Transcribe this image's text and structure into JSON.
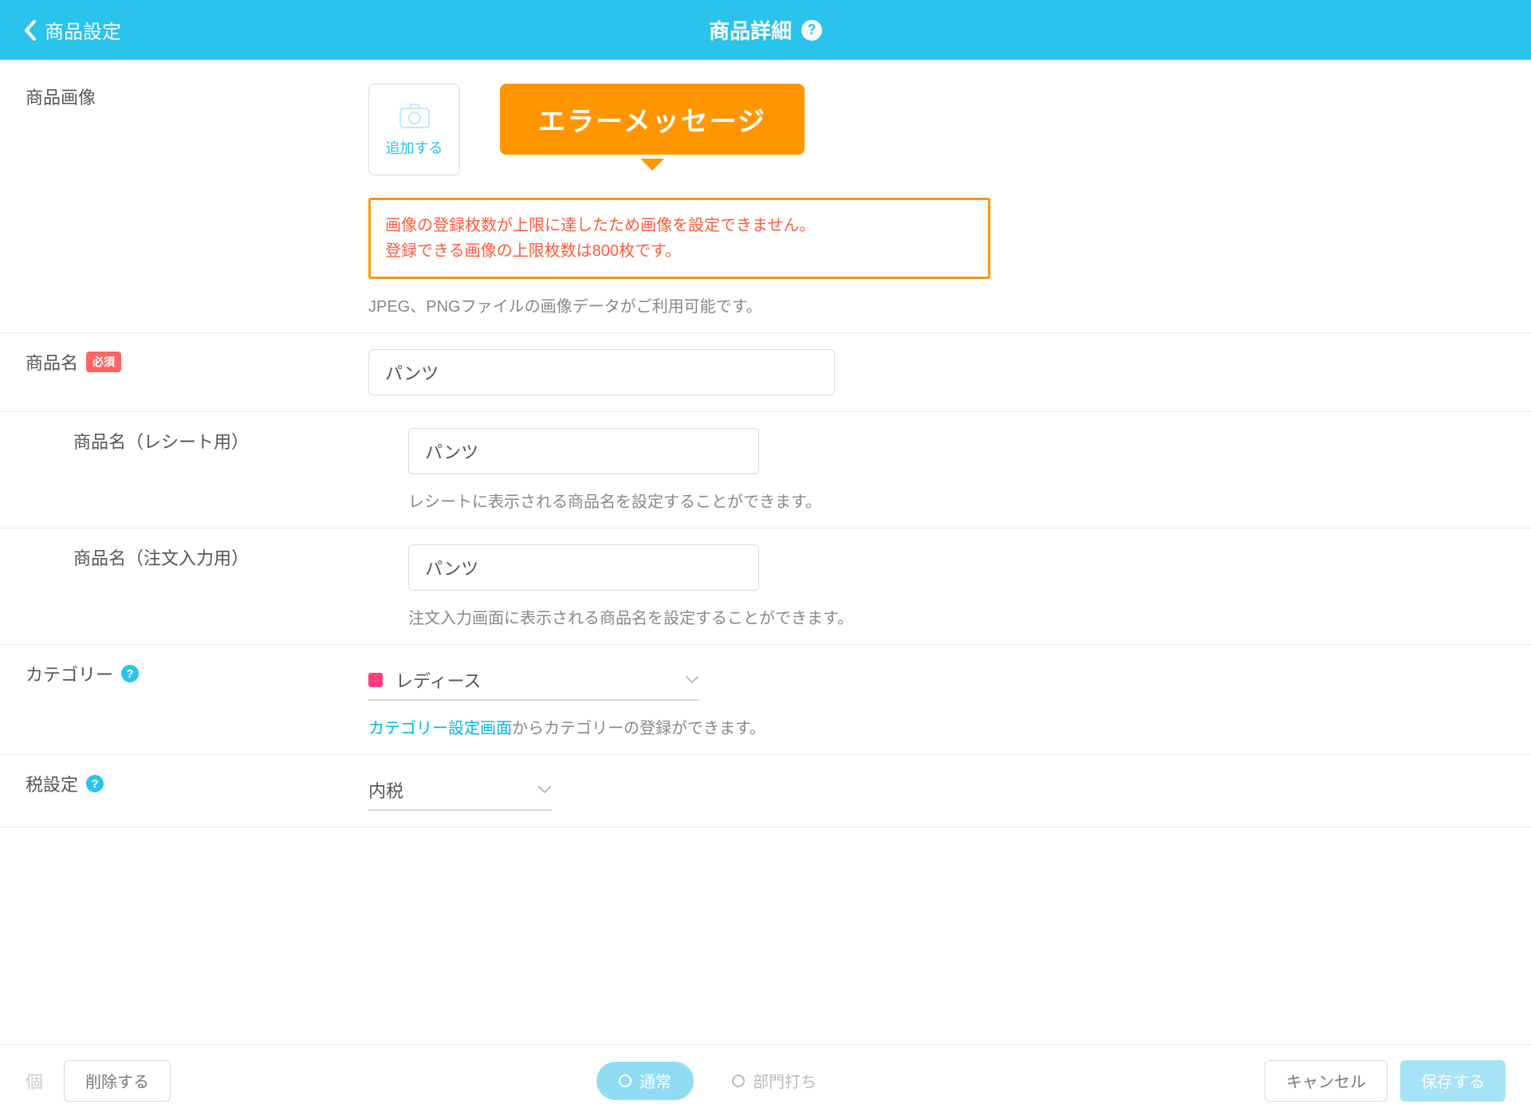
{
  "header": {
    "back_label": "商品設定",
    "title": "商品詳細"
  },
  "callout": {
    "text": "エラーメッセージ"
  },
  "image_section": {
    "label": "商品画像",
    "add_label": "追加する",
    "error_line1": "画像の登録枚数が上限に達したため画像を設定できません。",
    "error_line2": "登録できる画像の上限枚数は800枚です。",
    "hint": "JPEG、PNGファイルの画像データがご利用可能です。"
  },
  "name_section": {
    "label": "商品名",
    "required_badge": "必須",
    "value": "パンツ"
  },
  "receipt_name_section": {
    "label": "商品名（レシート用）",
    "value": "パンツ",
    "hint": "レシートに表示される商品名を設定することができます。"
  },
  "order_name_section": {
    "label": "商品名（注文入力用）",
    "value": "パンツ",
    "hint": "注文入力画面に表示される商品名を設定することができます。"
  },
  "category_section": {
    "label": "カテゴリー",
    "value": "レディース",
    "link_text": "カテゴリー設定画面",
    "hint_suffix": "からカテゴリーの登録ができます。"
  },
  "tax_section": {
    "label": "税設定",
    "value": "内税"
  },
  "footer": {
    "delete": "削除する",
    "cancel": "キャンセル",
    "save": "保存する",
    "mode_normal": "通常",
    "mode_dept": "部門打ち",
    "ghost": "個"
  }
}
